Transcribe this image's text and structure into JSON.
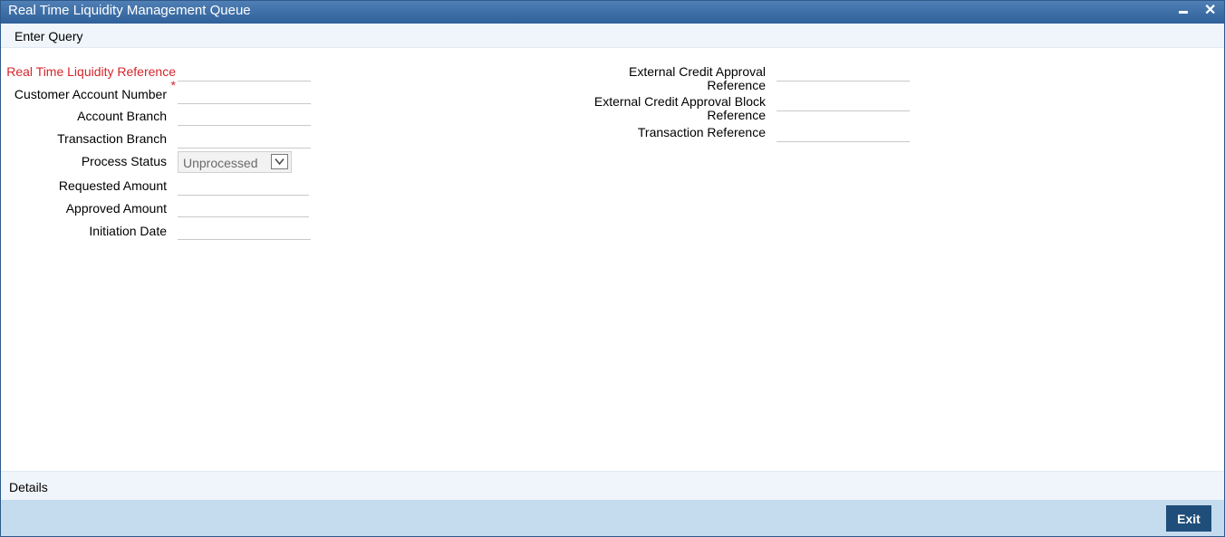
{
  "window": {
    "title": "Real Time Liquidity Management Queue",
    "minimize_glyph": "",
    "close_glyph": "✕"
  },
  "toolbar": {
    "enter_query": "Enter Query"
  },
  "form_left": {
    "rtl_reference": {
      "label": "Real Time Liquidity Reference",
      "required_mark": "*",
      "value": ""
    },
    "customer_account_number": {
      "label": "Customer Account Number",
      "value": ""
    },
    "account_branch": {
      "label": "Account Branch",
      "value": ""
    },
    "transaction_branch": {
      "label": "Transaction Branch",
      "value": ""
    },
    "process_status": {
      "label": "Process Status",
      "value": "Unprocessed"
    },
    "requested_amount": {
      "label": "Requested Amount",
      "value": ""
    },
    "approved_amount": {
      "label": "Approved Amount",
      "value": ""
    },
    "initiation_date": {
      "label": "Initiation Date",
      "value": ""
    }
  },
  "form_right": {
    "ext_credit_approval_ref": {
      "label_line1": "External Credit Approval",
      "label_line2": "Reference",
      "value": ""
    },
    "ext_credit_approval_block_ref": {
      "label_line1": "External Credit Approval Block",
      "label_line2": "Reference",
      "value": ""
    },
    "transaction_reference": {
      "label": "Transaction Reference",
      "value": ""
    }
  },
  "details": {
    "label": "Details"
  },
  "footer": {
    "exit_label": "Exit"
  },
  "colors": {
    "titlebar": "#2f609a",
    "required": "#d6252b",
    "footer": "#c5dcef",
    "exit_button": "#1f4e7a"
  }
}
